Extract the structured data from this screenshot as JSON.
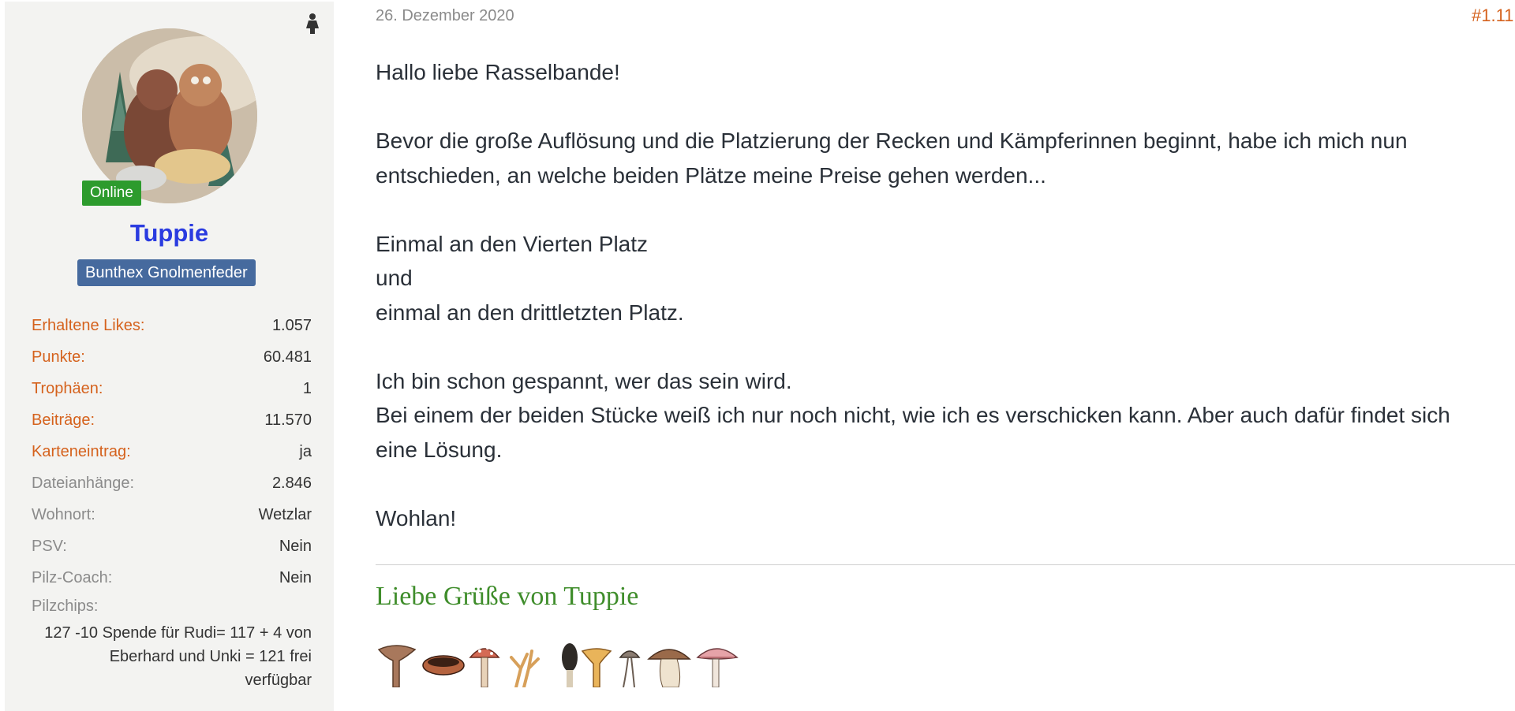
{
  "user": {
    "status": "Online",
    "name": "Tuppie",
    "rank": "Bunthex Gnolmenfeder",
    "stats": [
      {
        "label": "Erhaltene Likes:",
        "value": "1.057",
        "highlight": true
      },
      {
        "label": "Punkte:",
        "value": "60.481",
        "highlight": true
      },
      {
        "label": "Trophäen:",
        "value": "1",
        "highlight": true
      },
      {
        "label": "Beiträge:",
        "value": "11.570",
        "highlight": true
      },
      {
        "label": "Karteneintrag:",
        "value": "ja",
        "highlight": true
      },
      {
        "label": "Dateianhänge:",
        "value": "2.846",
        "highlight": false
      },
      {
        "label": "Wohnort:",
        "value": "Wetzlar",
        "highlight": false
      },
      {
        "label": "PSV:",
        "value": "Nein",
        "highlight": false
      },
      {
        "label": "Pilz-Coach:",
        "value": "Nein",
        "highlight": false
      }
    ],
    "pilzchips_label": "Pilzchips:",
    "pilzchips_lines": [
      "127 -10 Spende für Rudi= 117 + 4 von",
      "Eberhard und Unki = 121 frei",
      "verfügbar"
    ]
  },
  "post": {
    "date": "26. Dezember 2020",
    "number": "#1.11",
    "lines": [
      "Hallo liebe Rasselbande!",
      "",
      "Bevor die große Auflösung und die Platzierung der Recken und Kämpferinnen beginnt, habe ich mich nun",
      "entschieden, an welche beiden Plätze meine Preise gehen werden...",
      "",
      "Einmal an den Vierten Platz",
      "und",
      "einmal an den drittletzten Platz.",
      "",
      "Ich bin schon gespannt, wer das sein wird.",
      "Bei einem der beiden Stücke weiß ich nur noch nicht, wie ich es verschicken kann. Aber auch dafür findet sich",
      "eine Lösung.",
      "",
      "Wohlan!"
    ],
    "signature": "Liebe Grüße von Tuppie"
  },
  "colors": {
    "accent_orange": "#d5621d",
    "username_blue": "#2a3be0",
    "online_green": "#2d9b2d",
    "rank_blue": "#466a9e",
    "signature_green": "#3f8d2b"
  },
  "icons": {
    "gender": "female-icon",
    "signature_images": "mushroom-icons"
  }
}
